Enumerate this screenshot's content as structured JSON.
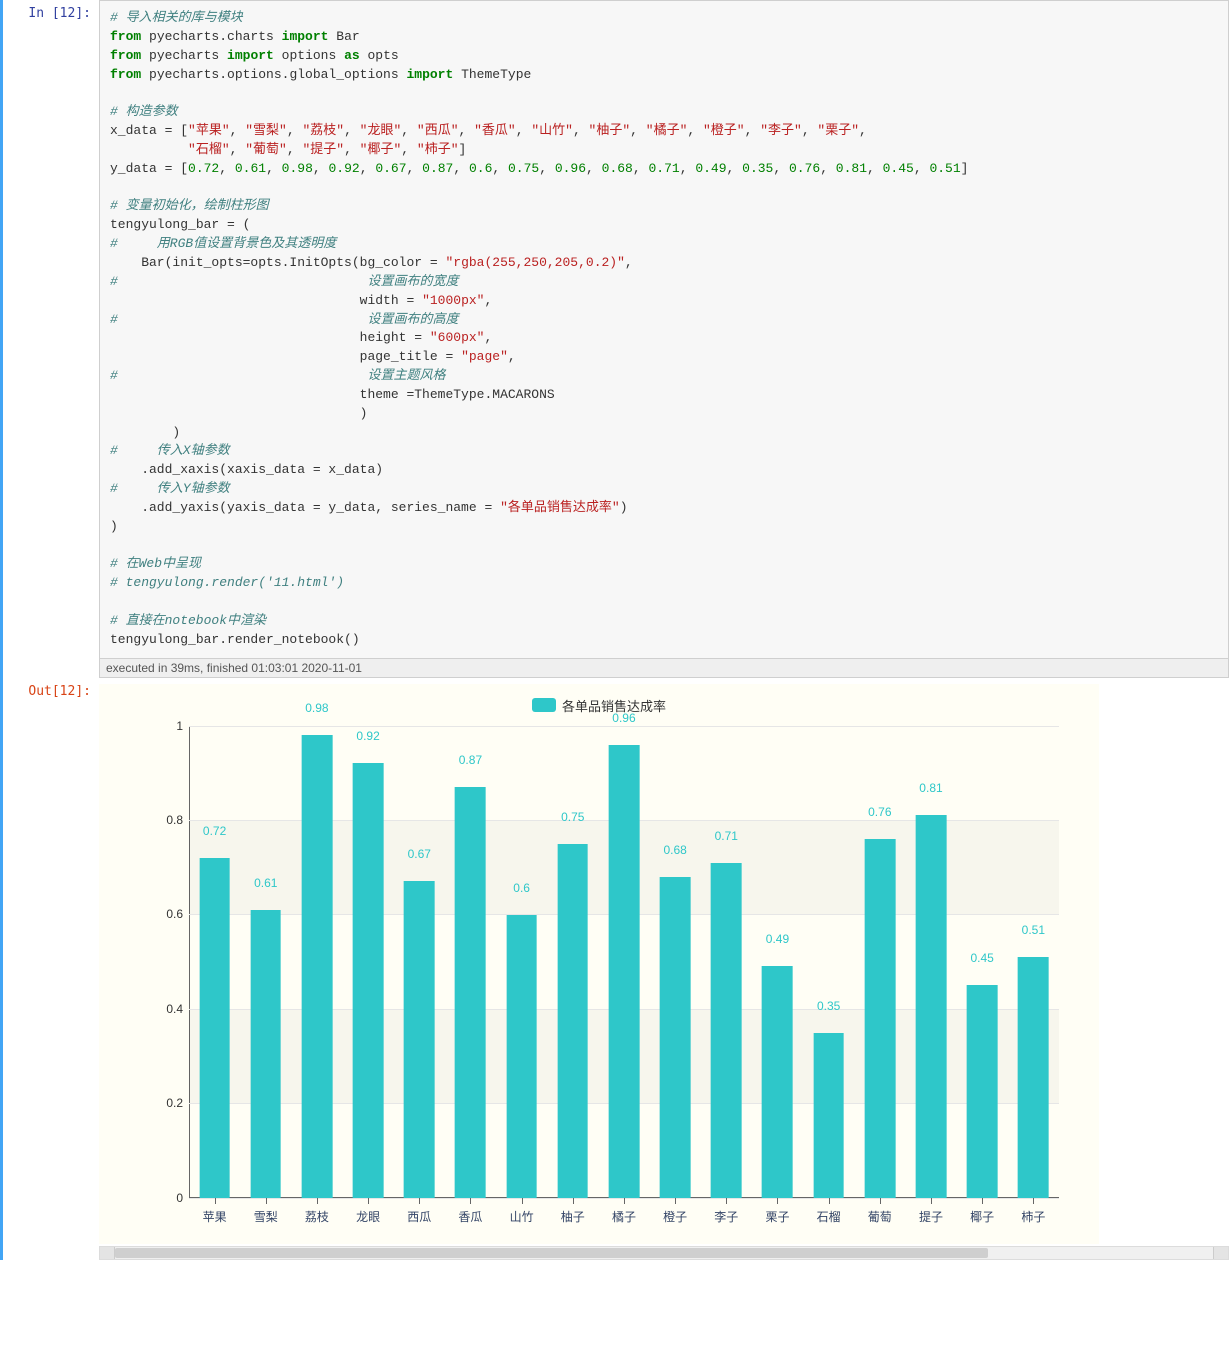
{
  "prompts": {
    "in": "In  [12]:",
    "out": "Out[12]:"
  },
  "code": {
    "c1": "# 导入相关的库与模块",
    "l2_from": "from",
    "l2_mod": " pyecharts.charts ",
    "l2_imp": "import",
    "l2_name": " Bar",
    "l3_from": "from",
    "l3_mod": " pyecharts ",
    "l3_imp": "import",
    "l3_name": " options ",
    "l3_as": "as",
    "l3_alias": " opts",
    "l4_from": "from",
    "l4_mod": " pyecharts.options.global_options ",
    "l4_imp": "import",
    "l4_name": " ThemeType",
    "c5": "# 构造参数",
    "l6a": "x_data = [",
    "l6z": ",",
    "l7_indent": "          ",
    "l7z": "]",
    "l8a": "y_data = [",
    "l8z": "]",
    "c9": "# 变量初始化，绘制柱形图",
    "l10": "tengyulong_bar = (",
    "c11": "#     用RGB值设置背景色及其透明度",
    "l12a": "    Bar(init_opts=opts.InitOpts(bg_color = ",
    "l12s": "\"rgba(255,250,205,0.2)\"",
    "l12z": ",",
    "c13": "#                                设置画布的宽度",
    "l14a": "                                width = ",
    "l14s": "\"1000px\"",
    "l14z": ",",
    "c15": "#                                设置画布的高度",
    "l16a": "                                height = ",
    "l16s": "\"600px\"",
    "l16z": ",",
    "l17a": "                                page_title = ",
    "l17s": "\"page\"",
    "l17z": ",",
    "c18": "#                                设置主题风格",
    "l19": "                                theme =ThemeType.MACARONS",
    "l20": "                                )",
    "l21": "        )",
    "c22": "#     传入X轴参数",
    "l23": "    .add_xaxis(xaxis_data = x_data)",
    "c24": "#     传入Y轴参数",
    "l25a": "    .add_yaxis(yaxis_data = y_data, series_name = ",
    "l25s": "\"各单品销售达成率\"",
    "l25z": ")",
    "l26": ")",
    "c27": "# 在Web中呈现",
    "c28": "# tengyulong.render('11.html')",
    "c29": "# 直接在notebook中渲染",
    "l30": "tengyulong_bar.render_notebook()"
  },
  "timing": "executed in 39ms, finished 01:03:01 2020-11-01",
  "chart_data": {
    "type": "bar",
    "series_name": "各单品销售达成率",
    "categories": [
      "苹果",
      "雪梨",
      "荔枝",
      "龙眼",
      "西瓜",
      "香瓜",
      "山竹",
      "柚子",
      "橘子",
      "橙子",
      "李子",
      "栗子",
      "石榴",
      "葡萄",
      "提子",
      "椰子",
      "柿子"
    ],
    "values": [
      0.72,
      0.61,
      0.98,
      0.92,
      0.67,
      0.87,
      0.6,
      0.75,
      0.96,
      0.68,
      0.71,
      0.49,
      0.35,
      0.76,
      0.81,
      0.45,
      0.51
    ],
    "ylim": [
      0,
      1
    ],
    "yticks": [
      0,
      0.2,
      0.4,
      0.6,
      0.8,
      1
    ],
    "bar_color": "#2ec7c9",
    "bg_color": "rgba(255,250,205,0.2)"
  },
  "xstr": [
    "\"苹果\"",
    "\"雪梨\"",
    "\"荔枝\"",
    "\"龙眼\"",
    "\"西瓜\"",
    "\"香瓜\"",
    "\"山竹\"",
    "\"柚子\"",
    "\"橘子\"",
    "\"橙子\"",
    "\"李子\"",
    "\"栗子\"",
    "\"石榴\"",
    "\"葡萄\"",
    "\"提子\"",
    "\"椰子\"",
    "\"柿子\""
  ],
  "ystr": [
    "0.72",
    "0.61",
    "0.98",
    "0.92",
    "0.67",
    "0.87",
    "0.6",
    "0.75",
    "0.96",
    "0.68",
    "0.71",
    "0.49",
    "0.35",
    "0.76",
    "0.81",
    "0.45",
    "0.51"
  ]
}
